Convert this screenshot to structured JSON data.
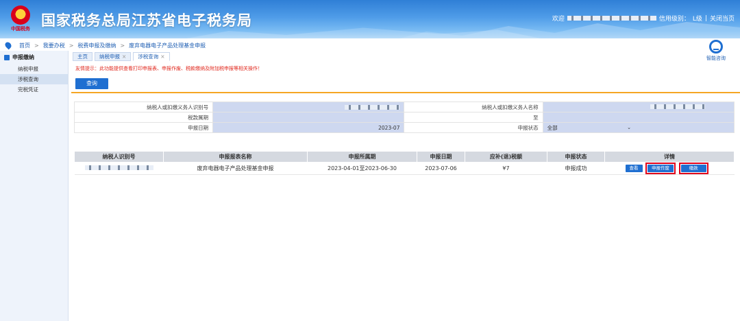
{
  "header": {
    "emblem_mark": "中国税务",
    "site_title": "国家税务总局江苏省电子税务局",
    "welcome": "欢迎",
    "credit_label": "信用级别：",
    "credit_value": "L级",
    "divider": "|",
    "close_label": "关闭当页"
  },
  "breadcrumb": {
    "items": [
      "首页",
      "我要办税",
      "税费申报及缴纳",
      "废弃电器电子产品处理基金申报"
    ],
    "separator": ">"
  },
  "sidebar": {
    "section": "申报缴纳",
    "items": [
      "纳税申报",
      "涉税查询",
      "完税凭证"
    ],
    "active_index": 1
  },
  "help": {
    "label": "智能咨询"
  },
  "tabs": [
    {
      "label": "主页",
      "closable": false
    },
    {
      "label": "纳税申报",
      "closable": true
    },
    {
      "label": "涉税查询",
      "closable": true
    }
  ],
  "tab_close": "×",
  "notice": "友情提示：此功能提供查看打印申报表、申报作废、税款缴纳及附加税申报等相关操作！",
  "query_button": "查询",
  "form": {
    "taxpayer_id_label": "纳税人或扣缴义务人识别号",
    "taxpayer_name_label": "纳税人或扣缴义务人名称",
    "period_label": "税款属期",
    "to_label": "至",
    "date_label": "申报日期",
    "date_value": "2023-07",
    "status_label": "申报状态",
    "status_value": "全部"
  },
  "table": {
    "headers": [
      "纳税人识别号",
      "申报报表名称",
      "申报所属期",
      "申报日期",
      "应补(退)税额",
      "申报状态",
      "详情"
    ],
    "rows": [
      {
        "report_name": "废弃电器电子产品处理基金申报",
        "period": "2023-04-01至2023-06-30",
        "date": "2023-07-06",
        "amount": "¥7",
        "status": "申报成功",
        "view_label": "查看",
        "void_label": "申报作废",
        "pay_label": "缴款"
      }
    ]
  },
  "colors": {
    "primary": "#1f6fd1",
    "notice": "#e0261b",
    "highlight": "#e0001b",
    "accent_line": "#f5a623"
  }
}
